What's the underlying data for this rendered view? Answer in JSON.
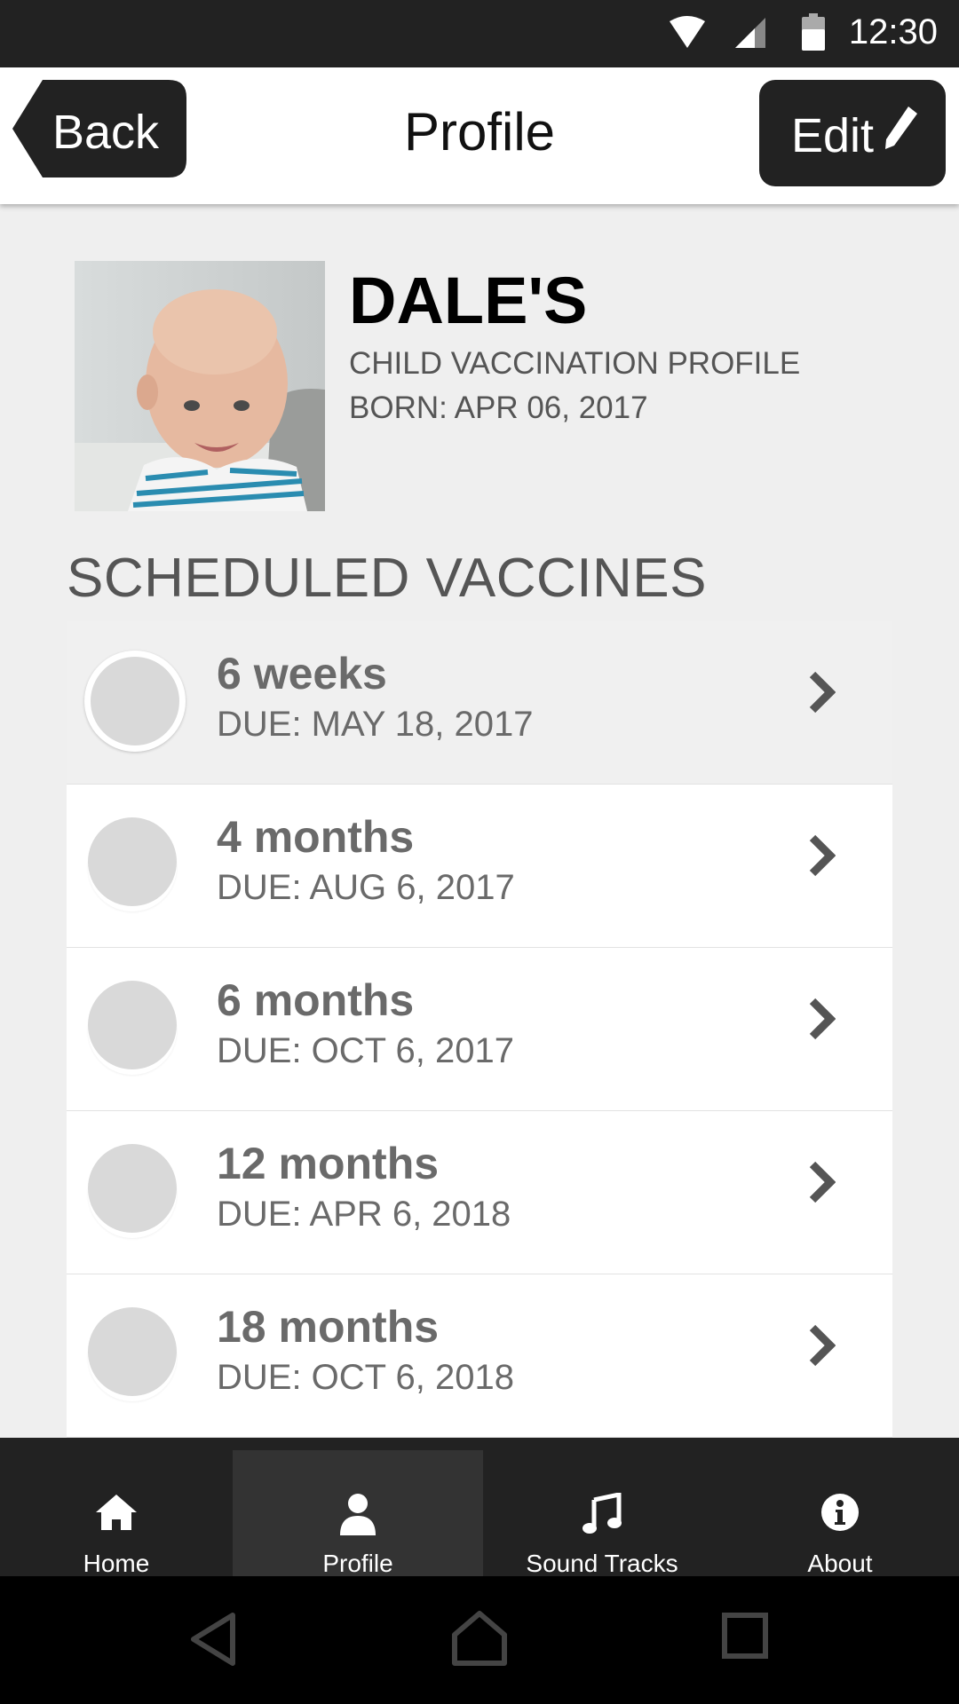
{
  "status_bar": {
    "time": "12:30",
    "icons": [
      "wifi-icon",
      "cell-signal-icon",
      "battery-icon"
    ]
  },
  "header": {
    "back_label": "Back",
    "title": "Profile",
    "edit_label": "Edit",
    "edit_icon": "pencil-icon"
  },
  "profile": {
    "name": "DALE'S",
    "subtitle": "CHILD VACCINATION PROFILE",
    "born": "BORN: APR 06, 2017"
  },
  "vaccines": {
    "section_title": "SCHEDULED VACCINES",
    "items": [
      {
        "age": "6 weeks",
        "due": "DUE: MAY 18, 2017"
      },
      {
        "age": "4 months",
        "due": "DUE: AUG 6, 2017"
      },
      {
        "age": "6 months",
        "due": "DUE: OCT 6, 2017"
      },
      {
        "age": "12 months",
        "due": "DUE: APR 6, 2018"
      },
      {
        "age": "18 months",
        "due": "DUE: OCT 6, 2018"
      }
    ]
  },
  "bottom_nav": {
    "active": "Profile",
    "tabs": [
      {
        "label": "Home",
        "icon": "home-icon"
      },
      {
        "label": "Profile",
        "icon": "person-icon"
      },
      {
        "label": "Sound Tracks",
        "icon": "music-note-icon"
      },
      {
        "label": "About",
        "icon": "info-icon"
      }
    ]
  },
  "system_nav": {
    "icons": [
      "back-triangle-icon",
      "home-outline-icon",
      "recents-square-icon"
    ]
  },
  "colors": {
    "dark": "#222222",
    "background": "#efefef",
    "text_gray": "#6a6a6a"
  }
}
